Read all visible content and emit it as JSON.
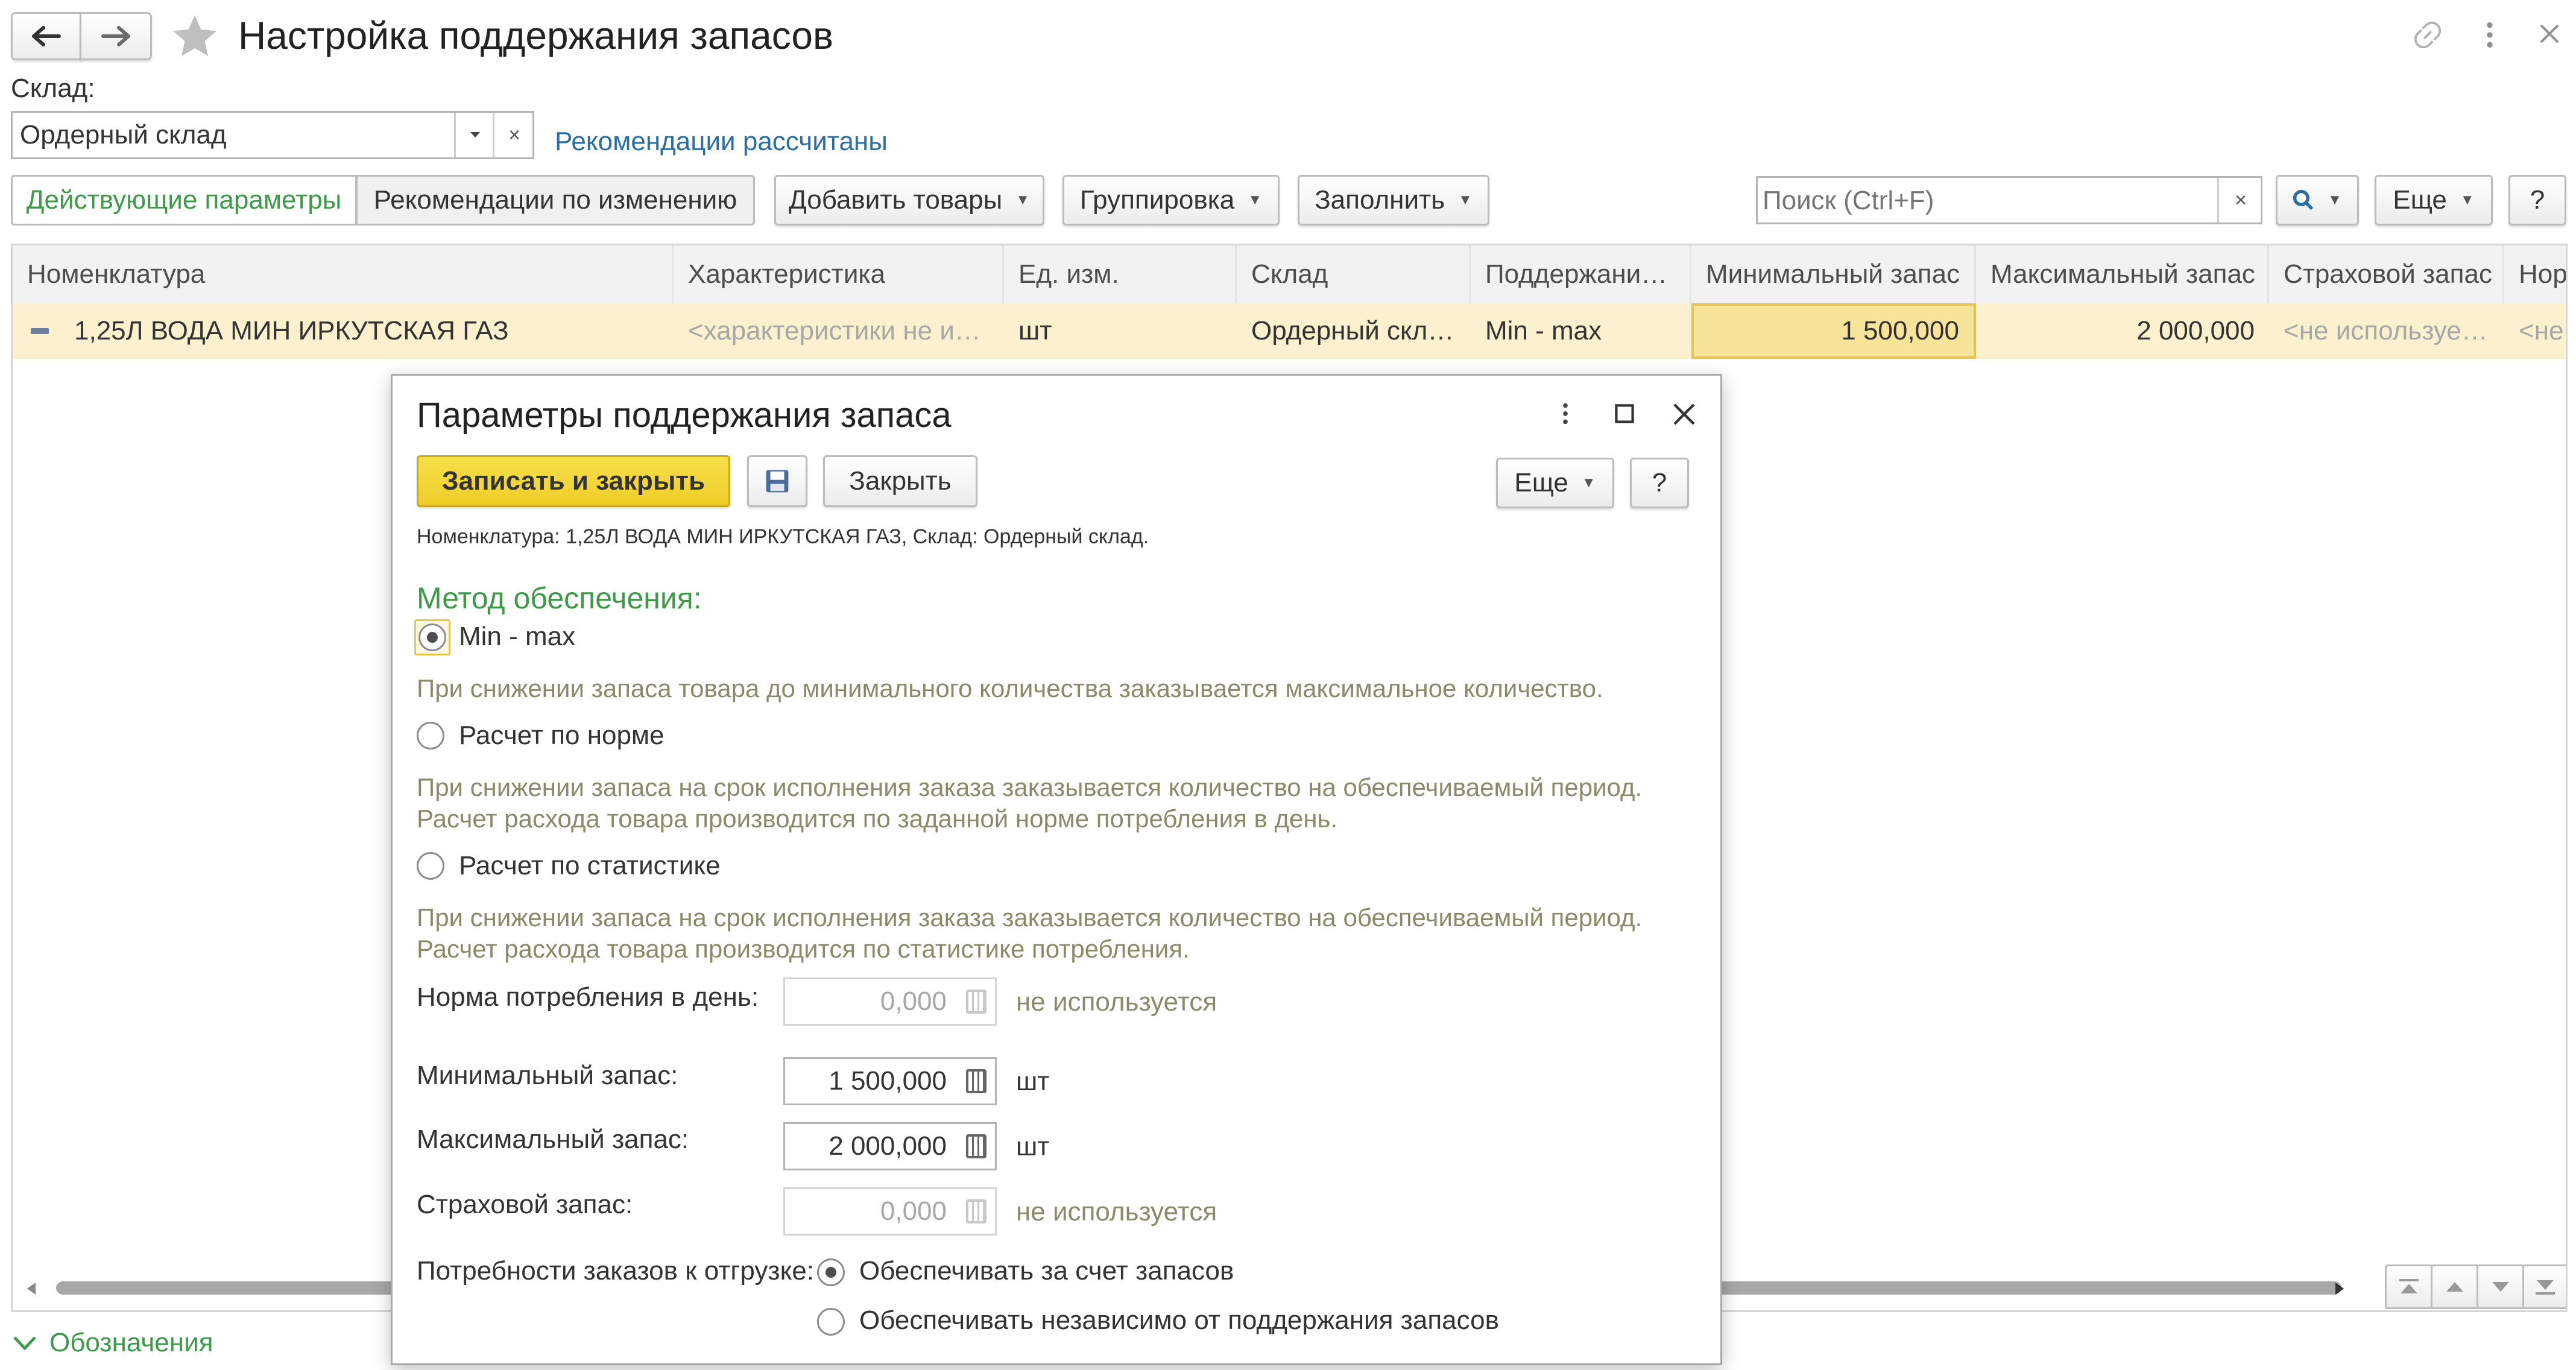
{
  "window": {
    "title": "Настройка поддержания запасов"
  },
  "warehouse": {
    "label": "Склад:",
    "value": "Ордерный склад",
    "status_link": "Рекомендации рассчитаны"
  },
  "toolbar": {
    "tab_active": "Действующие параметры",
    "tab_other": "Рекомендации по изменению",
    "add_goods": "Добавить товары",
    "grouping": "Группировка",
    "fill": "Заполнить",
    "search_placeholder": "Поиск (Ctrl+F)",
    "more": "Еще",
    "help": "?"
  },
  "table": {
    "columns": [
      "Номенклатура",
      "Характеристика",
      "Ед. изм.",
      "Склад",
      "Поддержани…",
      "Минимальный запас",
      "Максимальный запас",
      "Страховой запас",
      "Норм"
    ],
    "rows": [
      {
        "item": "1,25Л ВОДА МИН ИРКУТСКАЯ ГАЗ",
        "characteristic": "<характеристики не и…",
        "unit": "шт",
        "warehouse": "Ордерный скл…",
        "method": "Min - max",
        "min_stock": "1 500,000",
        "max_stock": "2 000,000",
        "safety_stock": "<не используе…",
        "norm": "<не"
      }
    ]
  },
  "legend_link": "Обозначения",
  "dialog": {
    "title": "Параметры поддержания запаса",
    "save_close": "Записать и закрыть",
    "close": "Закрыть",
    "more": "Еще",
    "help": "?",
    "info": "Номенклатура: 1,25Л ВОДА МИН ИРКУТСКАЯ ГАЗ, Склад: Ордерный склад.",
    "method_heading": "Метод обеспечения:",
    "methods": [
      {
        "label": "Min - max",
        "selected": true,
        "desc1": "При снижении запаса товара до минимального количества заказывается максимальное количество.",
        "desc2": ""
      },
      {
        "label": "Расчет по норме",
        "selected": false,
        "desc1": "При снижении запаса на срок исполнения заказа заказывается количество на обеспечиваемый период.",
        "desc2": "Расчет расхода товара производится по заданной норме потребления в день."
      },
      {
        "label": "Расчет по статистике",
        "selected": false,
        "desc1": "При снижении запаса на срок исполнения заказа заказывается количество на обеспечиваемый период.",
        "desc2": "Расчет расхода товара производится по статистике потребления."
      }
    ],
    "fields": {
      "norm": {
        "label": "Норма потребления в день:",
        "value": "0,000",
        "suffix": "не используется"
      },
      "min": {
        "label": "Минимальный запас:",
        "value": "1 500,000",
        "suffix": "шт"
      },
      "max": {
        "label": "Максимальный запас:",
        "value": "2 000,000",
        "suffix": "шт"
      },
      "safety": {
        "label": "Страховой запас:",
        "value": "0,000",
        "suffix": "не используется"
      }
    },
    "orders": {
      "label": "Потребности заказов к отгрузке:",
      "options": [
        "Обеспечивать за счет запасов",
        "Обеспечивать независимо от поддержания запасов"
      ]
    }
  },
  "colors": {
    "accent_green": "#3d9a48",
    "link_blue": "#2a6ea6",
    "row_highlight": "#fbf1cf",
    "cell_highlight": "#f8e39a",
    "primary_button": "#f2d535"
  }
}
